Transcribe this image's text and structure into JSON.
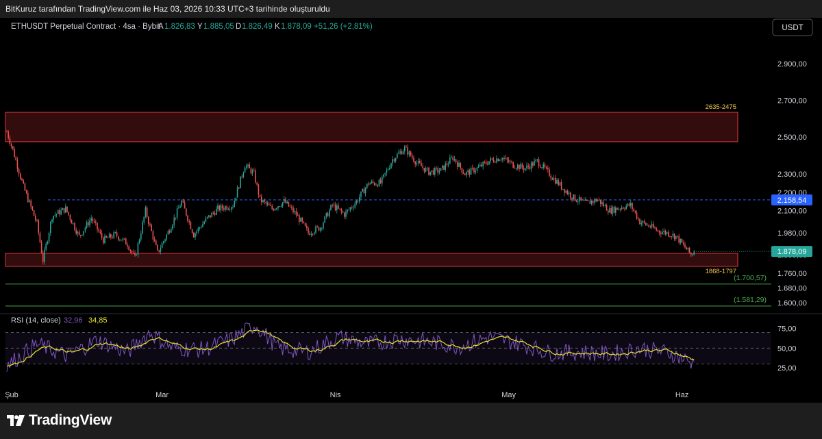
{
  "header": {
    "snapshot_text": "BitKuruz tarafından TradingView.com ile Haz 03, 2026 10:33 UTC+3 tarihinde oluşturuldu"
  },
  "legend": {
    "symbol": "ETHUSDT Perpetual Contract · 4sa · Bybit",
    "open_label": "A",
    "open_value": "1.826,83",
    "high_label": "Y",
    "high_value": "1.885,05",
    "low_label": "D",
    "low_value": "1.826,49",
    "close_label": "K",
    "close_value": "1.878,09",
    "change": "+51,26 (+2,81%)"
  },
  "currency_button": "USDT",
  "colors": {
    "up": "#26a69a",
    "down": "#ef5350",
    "zone": "#e8383d",
    "level_blue": "#2962ff",
    "level_green": "#4caf50",
    "rsi": "#7e57c2",
    "rsi_ma": "#e6e32b",
    "zone_label": "#f2c94c"
  },
  "chart_data": {
    "type": "candlestick",
    "x_ticks": [
      "Şub",
      "Mar",
      "Nis",
      "May",
      "Haz"
    ],
    "y_ticks": [
      "2.900,00",
      "2.700,00",
      "2.500,00",
      "2.300,00",
      "2.200,00",
      "2.100,00",
      "1.980,00",
      "1.860,00",
      "1.760,00",
      "1.680,00",
      "1.600,00"
    ],
    "y_tick_values": [
      2900,
      2700,
      2500,
      2300,
      2200,
      2100,
      1980,
      1860,
      1760,
      1680,
      1600
    ],
    "y_range": [
      1562,
      3030
    ],
    "price_path": [
      [
        0,
        2530
      ],
      [
        4,
        2430
      ],
      [
        11,
        2230
      ],
      [
        20,
        2030
      ],
      [
        24,
        1830
      ],
      [
        30,
        2070
      ],
      [
        39,
        2110
      ],
      [
        48,
        1960
      ],
      [
        56,
        2060
      ],
      [
        64,
        1940
      ],
      [
        72,
        1970
      ],
      [
        80,
        1920
      ],
      [
        85,
        1840
      ],
      [
        92,
        2100
      ],
      [
        100,
        1870
      ],
      [
        108,
        2000
      ],
      [
        116,
        2150
      ],
      [
        124,
        1970
      ],
      [
        132,
        2050
      ],
      [
        140,
        2110
      ],
      [
        150,
        2130
      ],
      [
        158,
        2350
      ],
      [
        164,
        2300
      ],
      [
        168,
        2160
      ],
      [
        176,
        2110
      ],
      [
        184,
        2150
      ],
      [
        192,
        2080
      ],
      [
        200,
        1980
      ],
      [
        208,
        2010
      ],
      [
        216,
        2130
      ],
      [
        224,
        2080
      ],
      [
        232,
        2150
      ],
      [
        240,
        2250
      ],
      [
        248,
        2250
      ],
      [
        256,
        2380
      ],
      [
        264,
        2440
      ],
      [
        272,
        2360
      ],
      [
        280,
        2310
      ],
      [
        288,
        2320
      ],
      [
        296,
        2390
      ],
      [
        304,
        2300
      ],
      [
        312,
        2330
      ],
      [
        320,
        2370
      ],
      [
        328,
        2390
      ],
      [
        336,
        2350
      ],
      [
        344,
        2330
      ],
      [
        352,
        2370
      ],
      [
        360,
        2300
      ],
      [
        368,
        2230
      ],
      [
        376,
        2170
      ],
      [
        384,
        2140
      ],
      [
        392,
        2160
      ],
      [
        400,
        2100
      ],
      [
        408,
        2120
      ],
      [
        414,
        2130
      ],
      [
        420,
        2040
      ],
      [
        428,
        2010
      ],
      [
        432,
        1990
      ],
      [
        438,
        1980
      ],
      [
        444,
        1960
      ],
      [
        450,
        1900
      ],
      [
        454,
        1860
      ],
      [
        456,
        1878
      ]
    ],
    "zones": [
      {
        "label": "2635-2475",
        "top": 2635,
        "bottom": 2475
      },
      {
        "label": "1868-1797",
        "top": 1868,
        "bottom": 1797
      }
    ],
    "levels": [
      {
        "label": "2.158,54",
        "value": 2158.54,
        "style": "dashed-blue"
      },
      {
        "label": "(1.700,57)",
        "value": 1700.57,
        "style": "green"
      },
      {
        "label": "(1.581,29)",
        "value": 1581.29,
        "style": "green"
      }
    ],
    "last_price": {
      "label": "1.878,09",
      "value": 1878.09
    },
    "rsi": {
      "label": "RSI (14, close)",
      "value": "32,96",
      "ma_value": "34,85",
      "y_ticks": [
        "75,00",
        "50,00",
        "25,00"
      ],
      "y_tick_values": [
        75,
        50,
        25
      ],
      "band": [
        30,
        70
      ],
      "path": [
        [
          0,
          28
        ],
        [
          20,
          55
        ],
        [
          40,
          40
        ],
        [
          60,
          60
        ],
        [
          80,
          45
        ],
        [
          95,
          70
        ],
        [
          110,
          50
        ],
        [
          130,
          48
        ],
        [
          150,
          62
        ],
        [
          165,
          80
        ],
        [
          180,
          50
        ],
        [
          200,
          45
        ],
        [
          220,
          64
        ],
        [
          240,
          55
        ],
        [
          260,
          62
        ],
        [
          280,
          58
        ],
        [
          300,
          52
        ],
        [
          320,
          64
        ],
        [
          340,
          56
        ],
        [
          360,
          44
        ],
        [
          380,
          45
        ],
        [
          400,
          42
        ],
        [
          420,
          50
        ],
        [
          440,
          44
        ],
        [
          456,
          30
        ]
      ]
    }
  }
}
